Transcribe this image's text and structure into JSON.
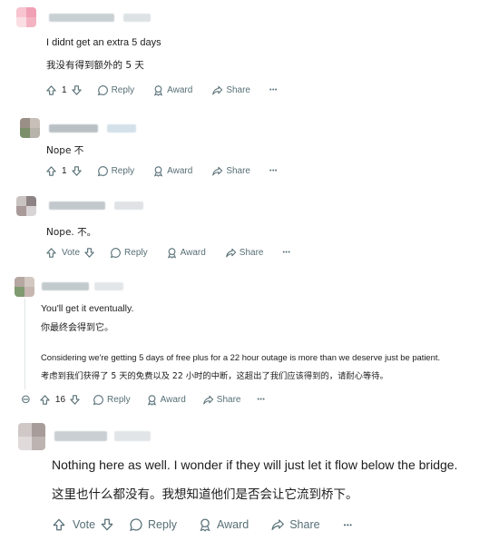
{
  "comments": [
    {
      "body": "I didnt get an extra 5 days",
      "translation": "我没有得到额外的 5 天",
      "vote_count": "1",
      "reply_label": "Reply",
      "award_label": "Award",
      "share_label": "Share",
      "more_label": "•••"
    },
    {
      "body": "Nope  不",
      "vote_count": "1",
      "reply_label": "Reply",
      "award_label": "Award",
      "share_label": "Share",
      "more_label": "•••"
    },
    {
      "body": "Nope.  不。",
      "vote_label": "Vote",
      "reply_label": "Reply",
      "award_label": "Award",
      "share_label": "Share",
      "more_label": "•••"
    },
    {
      "body": "You'll get it eventually.",
      "translation": "你最终会得到它。",
      "body2": "Considering we're getting 5 days of free plus for a 22 hour outage is more than we deserve just be patient.",
      "translation2": "考虑到我们获得了 5 天的免费以及 22 小时的中断，这超出了我们应该得到的，请耐心等待。",
      "collapse_icon": "⊖",
      "vote_count": "16",
      "reply_label": "Reply",
      "award_label": "Award",
      "share_label": "Share",
      "more_label": "•••"
    },
    {
      "body": "Nothing here as well. I wonder if they will just let it flow below the bridge.",
      "translation": "这里也什么都没有。我想知道他们是否会让它流到桥下。",
      "vote_label": "Vote",
      "reply_label": "Reply",
      "award_label": "Award",
      "share_label": "Share",
      "more_label": "•••"
    }
  ],
  "icons": {
    "upvote": "arrow-up-icon",
    "downvote": "arrow-down-icon",
    "reply": "speech-bubble-icon",
    "award": "award-ribbon-icon",
    "share": "share-arrow-icon",
    "more": "ellipsis-icon",
    "collapse": "collapse-minus-icon"
  },
  "colors": {
    "meta_text": "#576f76",
    "body_text": "#1c1c1c",
    "thread_line": "#e0e4e6"
  }
}
